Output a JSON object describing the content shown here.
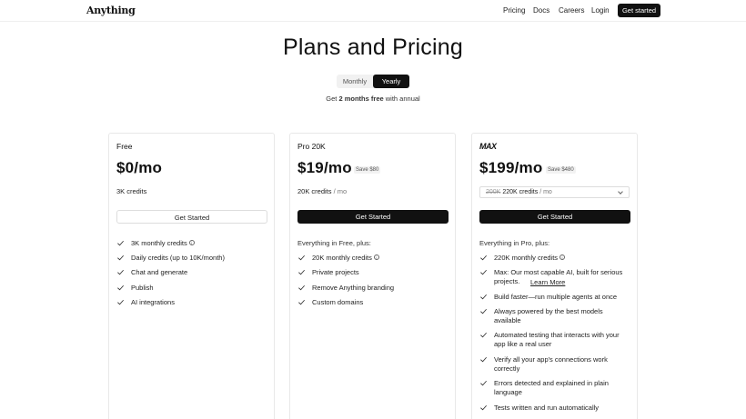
{
  "nav": {
    "logo": "Anything",
    "links": [
      "Pricing",
      "Docs",
      "Careers",
      "Login"
    ],
    "cta": "Get started"
  },
  "hero": {
    "title": "Plans and Pricing",
    "toggle": {
      "monthly": "Monthly",
      "yearly": "Yearly",
      "selected": "Yearly"
    },
    "promo_prefix": "Get",
    "promo_bold": "2 months",
    "promo_free": "free",
    "promo_suffix": "with annual"
  },
  "plans": [
    {
      "name": "Free",
      "price": "$0/mo",
      "credits": "3K credits",
      "cta": "Get Started",
      "features": [
        "3K monthly credits",
        "Daily credits (up to 10K/month)",
        "Chat and generate",
        "Publish",
        "AI integrations"
      ]
    },
    {
      "name": "Pro 20K",
      "price": "$19/mo",
      "save": "Save $80",
      "credits": "20K credits",
      "credits_suffix": "/ mo",
      "cta": "Get Started",
      "everything": "Everything in Free, plus:",
      "features": [
        "20K monthly credits",
        "Private projects",
        "Remove Anything branding",
        "Custom domains"
      ]
    },
    {
      "name": "MAX",
      "price": "$199/mo",
      "save": "Save $480",
      "credits_old": "200K",
      "credits": "220K credits",
      "credits_suffix": "/ mo",
      "cta": "Get Started",
      "everything": "Everything in Pro, plus:",
      "features": [
        "220K monthly credits",
        "Max: Our most capable AI, built for serious projects.",
        "Learn More",
        "Build faster—run multiple agents at once",
        "Always powered by the best models available",
        "Automated testing that interacts with your app like a real user",
        "Verify all your app's connections work correctly",
        "Errors detected and explained in plain language",
        "Tests written and run automatically"
      ]
    }
  ]
}
